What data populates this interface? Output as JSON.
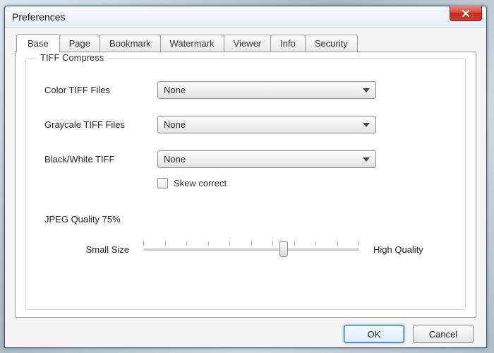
{
  "window": {
    "title": "Preferences"
  },
  "tabs": [
    {
      "label": "Base"
    },
    {
      "label": "Page"
    },
    {
      "label": "Bookmark"
    },
    {
      "label": "Watermark"
    },
    {
      "label": "Viewer"
    },
    {
      "label": "Info"
    },
    {
      "label": "Security"
    }
  ],
  "group": {
    "title": "TIFF Compress",
    "color_label": "Color TIFF Files",
    "color_value": "None",
    "gray_label": "Graycale TIFF Files",
    "gray_value": "None",
    "bw_label": "Black/White TIFF",
    "bw_value": "None",
    "skew_label": "Skew correct",
    "jpeg_label": "JPEG Quality  75%",
    "slider_left": "Small Size",
    "slider_right": "High Quality",
    "slider_value_percent": 75
  },
  "buttons": {
    "ok": "OK",
    "cancel": "Cancel"
  }
}
